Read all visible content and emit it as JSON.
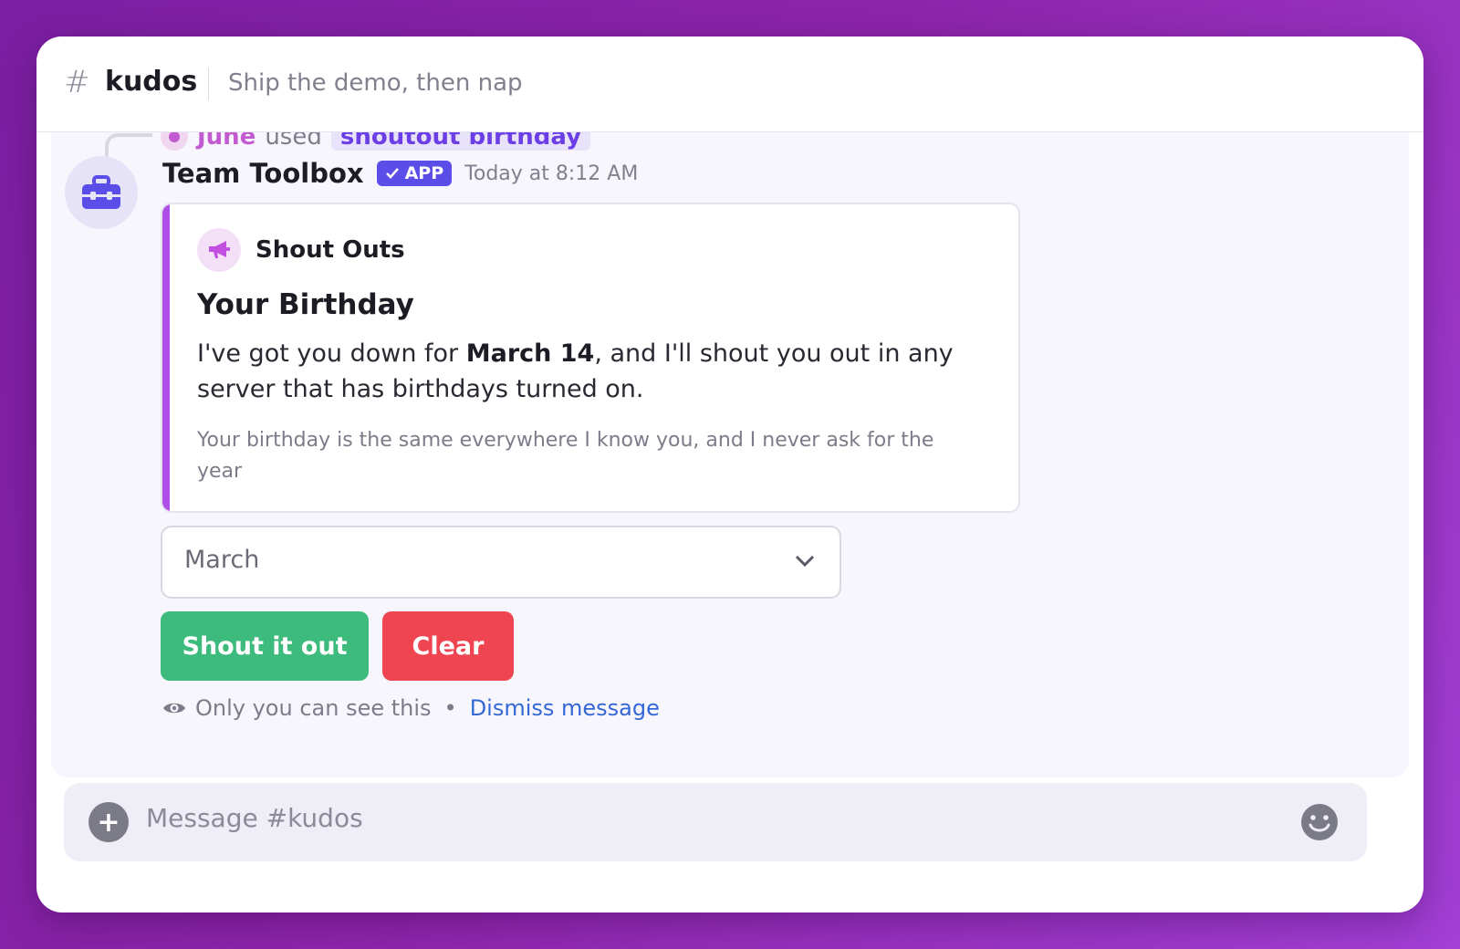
{
  "header": {
    "hash": "#",
    "channel": "kudos",
    "topic": "Ship the demo, then nap"
  },
  "context": {
    "user": "June",
    "used": "used",
    "command": "shoutout birthday"
  },
  "message": {
    "author": "Team Toolbox",
    "badge": "APP",
    "timestamp": "Today at 8:12 AM"
  },
  "card": {
    "title": "Shout Outs",
    "heading": "Your Birthday",
    "body_prefix": "I've got you down for ",
    "body_bold": "March 14",
    "body_suffix": ", and I'll shout you out in any server that has birthdays turned on.",
    "footnote": "Your birthday is the same everywhere I know you, and I never ask for the year"
  },
  "select": {
    "value": "March"
  },
  "buttons": {
    "primary": "Shout it out",
    "danger": "Clear"
  },
  "ephemeral": {
    "text": "Only you can see this",
    "separator": "•",
    "dismiss": "Dismiss message"
  },
  "composer": {
    "placeholder": "Message #kudos"
  },
  "colors": {
    "accent": "#5b4de8",
    "card_bar": "#b04ee8",
    "primary_button": "#3dbb7d",
    "danger_button": "#ef4550",
    "link": "#3467d6"
  },
  "icons": {
    "bot_avatar": "toolbox-icon",
    "card_icon": "megaphone-icon",
    "badge_check": "check-icon",
    "select_chevron": "chevron-down-icon",
    "visibility": "eye-icon",
    "composer_add": "plus-icon",
    "composer_emoji": "smiley-icon"
  }
}
